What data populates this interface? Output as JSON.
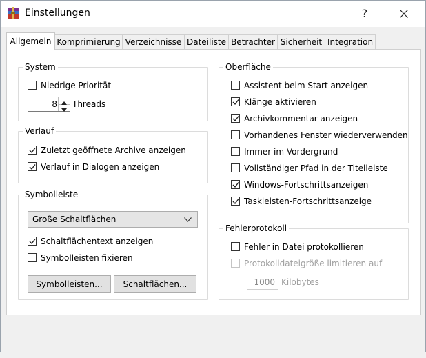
{
  "window": {
    "title": "Einstellungen",
    "help_label": "?"
  },
  "tabs": [
    {
      "label": "Allgemein",
      "active": true
    },
    {
      "label": "Komprimierung"
    },
    {
      "label": "Verzeichnisse"
    },
    {
      "label": "Dateiliste"
    },
    {
      "label": "Betrachter"
    },
    {
      "label": "Sicherheit"
    },
    {
      "label": "Integration"
    }
  ],
  "system": {
    "title": "System",
    "low_priority": {
      "label": "Niedrige Priorität",
      "checked": false
    },
    "threads": {
      "value": "8",
      "label": "Threads"
    }
  },
  "history": {
    "title": "Verlauf",
    "items": [
      {
        "label": "Zuletzt geöffnete Archive anzeigen",
        "checked": true
      },
      {
        "label": "Verlauf in Dialogen anzeigen",
        "checked": true
      }
    ]
  },
  "toolbar": {
    "title": "Symbolleiste",
    "size_select": "Große Schaltflächen",
    "items": [
      {
        "label": "Schaltflächentext anzeigen",
        "checked": true
      },
      {
        "label": "Symbolleisten fixieren",
        "checked": false
      }
    ],
    "toolbars_button": "Symbolleisten...",
    "buttons_button": "Schaltflächen..."
  },
  "interface": {
    "title": "Oberfläche",
    "items": [
      {
        "label": "Assistent beim Start anzeigen",
        "checked": false
      },
      {
        "label": "Klänge aktivieren",
        "checked": true
      },
      {
        "label": "Archivkommentar anzeigen",
        "checked": true
      },
      {
        "label": "Vorhandenes Fenster wiederverwenden",
        "checked": false
      },
      {
        "label": "Immer im Vordergrund",
        "checked": false
      },
      {
        "label": "Vollständiger Pfad in der Titelleiste",
        "checked": false
      },
      {
        "label": "Windows-Fortschrittsanzeigen",
        "checked": true
      },
      {
        "label": "Taskleisten-Fortschrittsanzeige",
        "checked": true
      }
    ]
  },
  "error_log": {
    "title": "Fehlerprotokoll",
    "log_to_file": {
      "label": "Fehler in Datei protokollieren",
      "checked": false
    },
    "limit_size": {
      "label": "Protokolldateigröße limitieren auf",
      "checked": false,
      "disabled": true
    },
    "size_value": "1000",
    "size_unit": "Kilobytes"
  }
}
